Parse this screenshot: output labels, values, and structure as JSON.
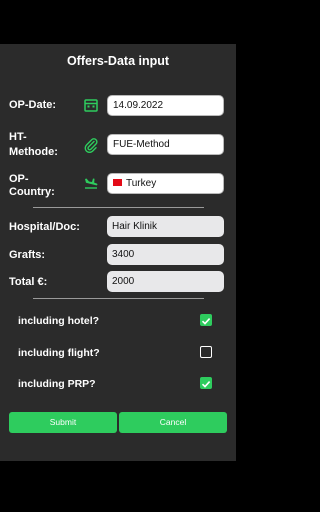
{
  "header": {
    "title": "Offers-Data input"
  },
  "op_date": {
    "label": "OP-Date:",
    "value": "14.09.2022",
    "icon": "calendar-icon"
  },
  "ht_method": {
    "label_line1": "HT-",
    "label_line2": "Methode:",
    "value": "FUE-Method",
    "icon": "paperclip-icon"
  },
  "op_country": {
    "label_line1": "OP-",
    "label_line2": "Country:",
    "value": "Turkey",
    "icon": "plane-landing-icon"
  },
  "hospital": {
    "label": "Hospital/Doc:",
    "value": "Hair Klinik"
  },
  "grafts": {
    "label": "Grafts:",
    "value": "3400"
  },
  "total": {
    "label": "Total €:",
    "value": "2000"
  },
  "options": [
    {
      "label": "including hotel?",
      "checked": true
    },
    {
      "label": "including flight?",
      "checked": false
    },
    {
      "label": "including PRP?",
      "checked": true
    }
  ],
  "buttons": {
    "submit": "Submit",
    "cancel": "Cancel"
  },
  "colors": {
    "accent": "#2ecc5e",
    "panel": "#2b2b2b",
    "background": "#000000"
  }
}
